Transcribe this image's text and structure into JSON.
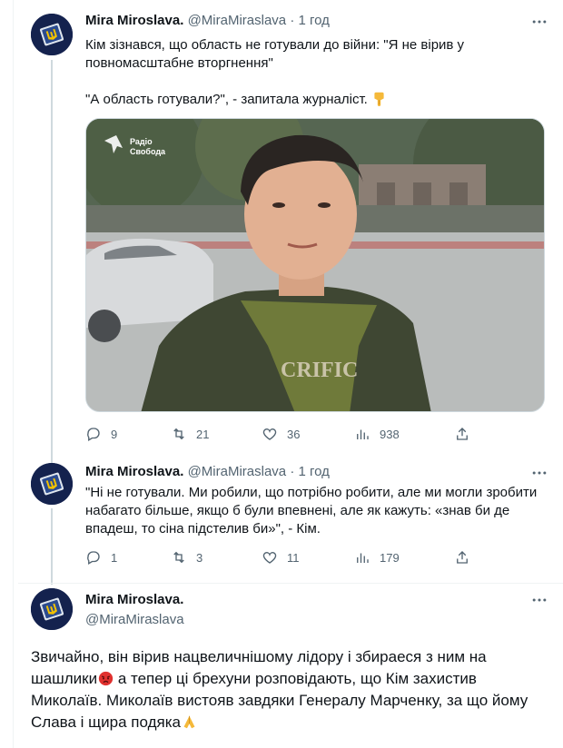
{
  "tweets": [
    {
      "name": "Mira Miroslava.",
      "handle": "@MiraMiraslava",
      "separator": "·",
      "time": "1 год",
      "text_line1": "Кім зізнався, що область не готували до війни: \"Я не вірив у",
      "text_line2": "повномасштабне вторгнення\"",
      "text_line3": "\"А область готували?\", - запитала журналіст.",
      "emoji": "backhand-index-down",
      "media": {
        "watermark_line1": "Радіо",
        "watermark_line2": "Свобода",
        "shirt_text": "CRIFIC"
      },
      "stats": {
        "replies": "9",
        "reposts": "21",
        "likes": "36",
        "views": "938"
      }
    },
    {
      "name": "Mira Miroslava.",
      "handle": "@MiraMiraslava",
      "separator": "·",
      "time": "1 год",
      "text_line1": "\"Ні не готували. Ми робили, що потрібно робити, але ми могли зробити",
      "text_line2": "набагато більше, якщо б були впевнені, але як кажуть: «знав би де",
      "text_line3": "впадеш, то сіна підстелив би»\", - Кім.",
      "stats": {
        "replies": "1",
        "reposts": "3",
        "likes": "11",
        "views": "179"
      }
    },
    {
      "name": "Mira Miroslava.",
      "handle": "@MiraMiraslava",
      "text_line1": "Звичайно, він вірив нацвеличнішому лідору і збираеся з ним на",
      "text_line2_a": "шашлики",
      "text_line2_b": " а тепер ці брехуни розповідають, що Кім захистив",
      "text_line3": "Миколаїв. Миколаїв вистояв завдяки Генералу Марченку, за що йому",
      "text_line4": "Слава і щира подяка"
    }
  ],
  "colors": {
    "text": "#0f1419",
    "secondary": "#536471",
    "thread_line": "#cfd9de",
    "avatar_bg": "#14224e"
  }
}
